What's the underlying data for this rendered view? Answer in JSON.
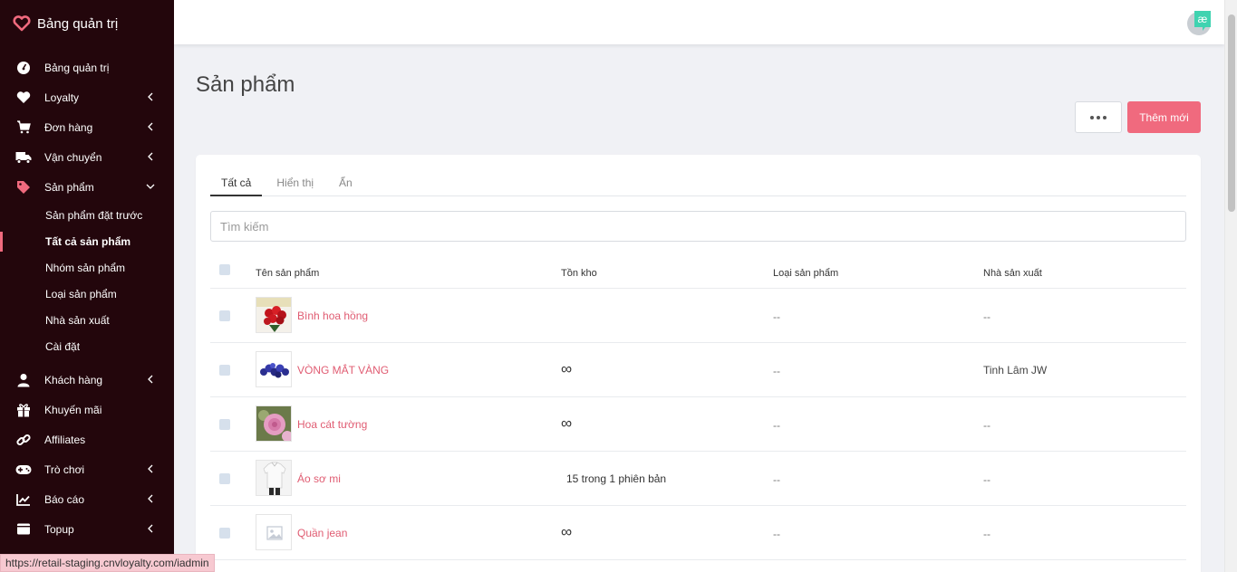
{
  "app": {
    "title": "Bảng quản trị",
    "brand_color": "#f06a7e"
  },
  "sidebar": {
    "items": [
      {
        "label": "Bảng quản trị",
        "icon": "gauge-icon"
      },
      {
        "label": "Loyalty",
        "icon": "heart-icon",
        "has_chevron": true,
        "chevron": "left"
      },
      {
        "label": "Đơn hàng",
        "icon": "cart-icon",
        "has_chevron": true,
        "chevron": "left"
      },
      {
        "label": "Vận chuyển",
        "icon": "truck-icon",
        "has_chevron": true,
        "chevron": "left"
      },
      {
        "label": "Sản phẩm",
        "icon": "tag-icon",
        "has_chevron": true,
        "chevron": "down"
      }
    ],
    "submenu": [
      {
        "label": "Sản phẩm đặt trước"
      },
      {
        "label": "Tất cả sản phẩm",
        "active": true
      },
      {
        "label": "Nhóm sản phẩm"
      },
      {
        "label": "Loại sản phẩm"
      },
      {
        "label": "Nhà sản xuất"
      },
      {
        "label": "Cài đặt"
      }
    ],
    "items_after": [
      {
        "label": "Khách hàng",
        "icon": "user-icon",
        "chevron": "left"
      },
      {
        "label": "Khuyến mãi",
        "icon": "gift-icon"
      },
      {
        "label": "Affiliates",
        "icon": "link-icon"
      },
      {
        "label": "Trò chơi",
        "icon": "gamepad-icon",
        "chevron": "left"
      },
      {
        "label": "Báo cáo",
        "icon": "chart-icon",
        "chevron": "left"
      },
      {
        "label": "Topup",
        "icon": "wallet-icon",
        "chevron": "left"
      }
    ]
  },
  "page": {
    "title": "Sản phẩm",
    "add_button": "Thêm mới",
    "tabs": [
      "Tất cả",
      "Hiển thị",
      "Ẩn"
    ],
    "search_placeholder": "Tìm kiếm"
  },
  "table": {
    "headers": [
      "Tên sản phẩm",
      "Tồn kho",
      "Loại sản phẩm",
      "Nhà sản xuất"
    ],
    "rows": [
      {
        "name": "Bình hoa hồng",
        "stock": "",
        "type": "--",
        "vendor": "--",
        "thumb": "red-roses"
      },
      {
        "name": "VÒNG MẮT VÀNG",
        "stock": "∞",
        "type": "--",
        "vendor": "Tinh Lâm JW",
        "thumb": "blue-beads"
      },
      {
        "name": "Hoa cát tường",
        "stock": "∞",
        "type": "--",
        "vendor": "--",
        "thumb": "pink-flowers"
      },
      {
        "name": "Áo sơ mi",
        "stock": "15  trong  1  phiên bản",
        "type": "--",
        "vendor": "--",
        "thumb": "white-shirt"
      },
      {
        "name": "Quần jean",
        "stock": "∞",
        "type": "--",
        "vendor": "--",
        "thumb": "placeholder-image"
      }
    ]
  },
  "statusbar": {
    "url": "https://retail-staging.cnvloyalty.com/iadmin"
  }
}
